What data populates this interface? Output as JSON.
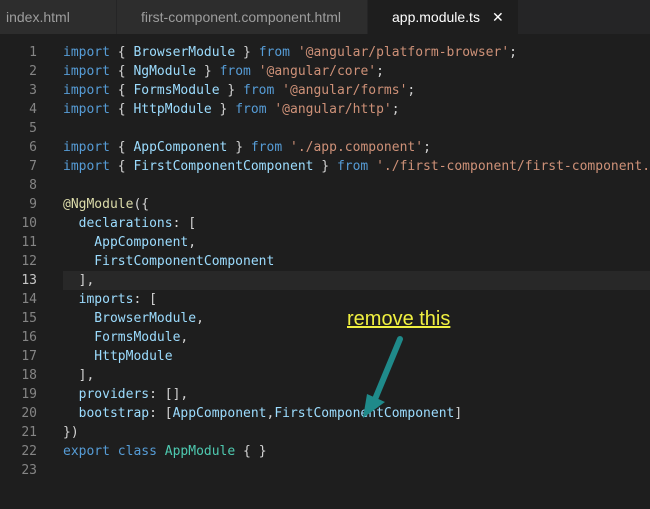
{
  "tabs": [
    {
      "label": "index.html"
    },
    {
      "label": "first-component.component.html"
    },
    {
      "label": "app.module.ts",
      "close": "✕"
    }
  ],
  "annotation": {
    "text": "remove this",
    "color": "#f0f040",
    "arrow_color": "#1f8a8a"
  },
  "editor": {
    "line_numbers": [
      "1",
      "2",
      "3",
      "4",
      "5",
      "6",
      "7",
      "8",
      "9",
      "10",
      "11",
      "12",
      "13",
      "14",
      "15",
      "16",
      "17",
      "18",
      "19",
      "20",
      "21",
      "22",
      "23"
    ],
    "current_line": 13,
    "lines": [
      [
        {
          "t": "import",
          "c": "kw"
        },
        {
          "t": " { ",
          "c": "pun"
        },
        {
          "t": "BrowserModule",
          "c": "prop"
        },
        {
          "t": " } ",
          "c": "pun"
        },
        {
          "t": "from",
          "c": "kw"
        },
        {
          "t": " ",
          "c": "pun"
        },
        {
          "t": "'@angular/platform-browser'",
          "c": "str"
        },
        {
          "t": ";",
          "c": "pun"
        }
      ],
      [
        {
          "t": "import",
          "c": "kw"
        },
        {
          "t": " { ",
          "c": "pun"
        },
        {
          "t": "NgModule",
          "c": "prop"
        },
        {
          "t": " } ",
          "c": "pun"
        },
        {
          "t": "from",
          "c": "kw"
        },
        {
          "t": " ",
          "c": "pun"
        },
        {
          "t": "'@angular/core'",
          "c": "str"
        },
        {
          "t": ";",
          "c": "pun"
        }
      ],
      [
        {
          "t": "import",
          "c": "kw"
        },
        {
          "t": " { ",
          "c": "pun"
        },
        {
          "t": "FormsModule",
          "c": "prop"
        },
        {
          "t": " } ",
          "c": "pun"
        },
        {
          "t": "from",
          "c": "kw"
        },
        {
          "t": " ",
          "c": "pun"
        },
        {
          "t": "'@angular/forms'",
          "c": "str"
        },
        {
          "t": ";",
          "c": "pun"
        }
      ],
      [
        {
          "t": "import",
          "c": "kw"
        },
        {
          "t": " { ",
          "c": "pun"
        },
        {
          "t": "HttpModule",
          "c": "prop"
        },
        {
          "t": " } ",
          "c": "pun"
        },
        {
          "t": "from",
          "c": "kw"
        },
        {
          "t": " ",
          "c": "pun"
        },
        {
          "t": "'@angular/http'",
          "c": "str"
        },
        {
          "t": ";",
          "c": "pun"
        }
      ],
      [],
      [
        {
          "t": "import",
          "c": "kw"
        },
        {
          "t": " { ",
          "c": "pun"
        },
        {
          "t": "AppComponent",
          "c": "prop"
        },
        {
          "t": " } ",
          "c": "pun"
        },
        {
          "t": "from",
          "c": "kw"
        },
        {
          "t": " ",
          "c": "pun"
        },
        {
          "t": "'./app.component'",
          "c": "str"
        },
        {
          "t": ";",
          "c": "pun"
        }
      ],
      [
        {
          "t": "import",
          "c": "kw"
        },
        {
          "t": " { ",
          "c": "pun"
        },
        {
          "t": "FirstComponentComponent",
          "c": "prop"
        },
        {
          "t": " } ",
          "c": "pun"
        },
        {
          "t": "from",
          "c": "kw"
        },
        {
          "t": " ",
          "c": "pun"
        },
        {
          "t": "'./first-component/first-component.co",
          "c": "str"
        }
      ],
      [],
      [
        {
          "t": "@NgModule",
          "c": "dec"
        },
        {
          "t": "({",
          "c": "pun"
        }
      ],
      [
        {
          "t": "  declarations",
          "c": "prop"
        },
        {
          "t": ": [",
          "c": "pun"
        }
      ],
      [
        {
          "t": "    AppComponent",
          "c": "prop"
        },
        {
          "t": ",",
          "c": "pun"
        }
      ],
      [
        {
          "t": "    FirstComponentComponent",
          "c": "prop"
        }
      ],
      [
        {
          "t": "  ],",
          "c": "pun"
        }
      ],
      [
        {
          "t": "  imports",
          "c": "prop"
        },
        {
          "t": ": [",
          "c": "pun"
        }
      ],
      [
        {
          "t": "    BrowserModule",
          "c": "prop"
        },
        {
          "t": ",",
          "c": "pun"
        }
      ],
      [
        {
          "t": "    FormsModule",
          "c": "prop"
        },
        {
          "t": ",",
          "c": "pun"
        }
      ],
      [
        {
          "t": "    HttpModule",
          "c": "prop"
        }
      ],
      [
        {
          "t": "  ],",
          "c": "pun"
        }
      ],
      [
        {
          "t": "  providers",
          "c": "prop"
        },
        {
          "t": ": [],",
          "c": "pun"
        }
      ],
      [
        {
          "t": "  bootstrap",
          "c": "prop"
        },
        {
          "t": ": [",
          "c": "pun"
        },
        {
          "t": "AppComponent",
          "c": "prop"
        },
        {
          "t": ",",
          "c": "pun"
        },
        {
          "t": "FirstComponentComponent",
          "c": "prop"
        },
        {
          "t": "]",
          "c": "pun"
        }
      ],
      [
        {
          "t": "})",
          "c": "pun"
        }
      ],
      [
        {
          "t": "export",
          "c": "kw"
        },
        {
          "t": " ",
          "c": "pun"
        },
        {
          "t": "class",
          "c": "kw"
        },
        {
          "t": " ",
          "c": "pun"
        },
        {
          "t": "AppModule",
          "c": "cls"
        },
        {
          "t": " { }",
          "c": "pun"
        }
      ],
      []
    ]
  }
}
